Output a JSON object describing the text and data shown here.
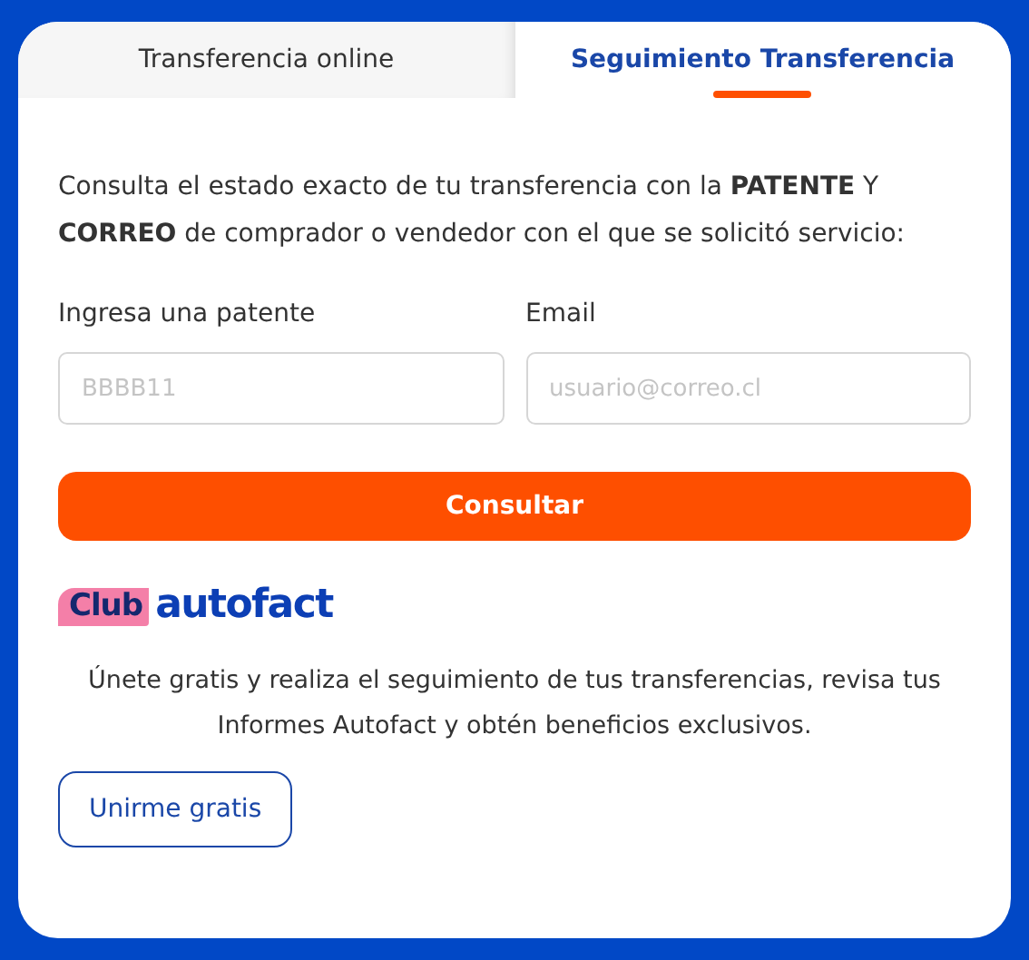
{
  "tabs": [
    {
      "label": "Transferencia online",
      "selected": false
    },
    {
      "label": "Seguimiento Transferencia",
      "selected": true
    }
  ],
  "intro": "Consulta el estado exacto de tu transferencia con la **PATENTE** Y **CORREO** de comprador o vendedor con el que se solicitó servicio:",
  "fields": [
    {
      "label": "Ingresa una patente",
      "placeholder": "BBBB11"
    },
    {
      "label": "Email",
      "placeholder": "usuario@correo.cl"
    }
  ],
  "submit_button": "Consultar",
  "logo": {
    "badge": "Club",
    "name": "autofact"
  },
  "promo_text": "Únete gratis y realiza el seguimiento de tus transferencias, revisa tus Informes Autofact y obtén beneficios exclusivos.",
  "join_button": "Unirme gratis"
}
